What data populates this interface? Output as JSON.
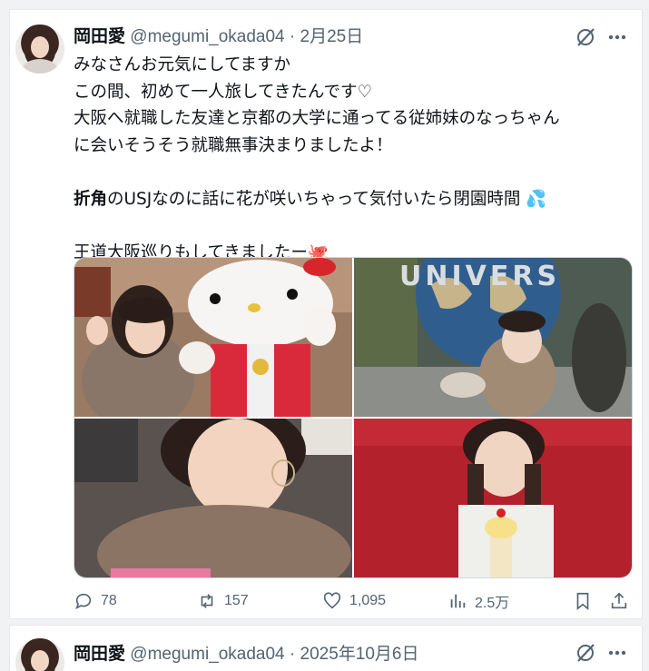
{
  "tweets": [
    {
      "name": "岡田愛",
      "handle": "@megumi_okada04",
      "separator": "·",
      "date": "2月25日",
      "lines": [
        "みなさんお元気にしてますか",
        "この間、初めて一人旅してきたんです♡",
        "大阪へ就職した友達と京都の大学に通ってる従姉妹のなっちゃん",
        "に会いそうそう就職無事決まりましたよ！"
      ],
      "line5_bold": "折角",
      "line5_rest": "のUSJなのに話に花が咲いちゃって気付いたら閉園時間",
      "line5_emoji": "💦",
      "line6": "王道大阪巡りもしてきましたー",
      "line6_emoji": "🐙",
      "stats": {
        "replies": "78",
        "reposts": "157",
        "likes": "1,095",
        "views": "2.5万"
      }
    },
    {
      "name": "岡田愛",
      "handle": "@megumi_okada04",
      "separator": "·",
      "date": "2025年10月6日"
    }
  ],
  "icons": {
    "grok": "grok-icon",
    "more": "more-icon",
    "reply": "reply-icon",
    "repost": "repost-icon",
    "like": "heart-icon",
    "views": "views-icon",
    "bookmark": "bookmark-icon",
    "share": "share-icon"
  },
  "colors": {
    "text": "#0f1419",
    "secondary": "#536471",
    "border": "#cfd9de"
  }
}
